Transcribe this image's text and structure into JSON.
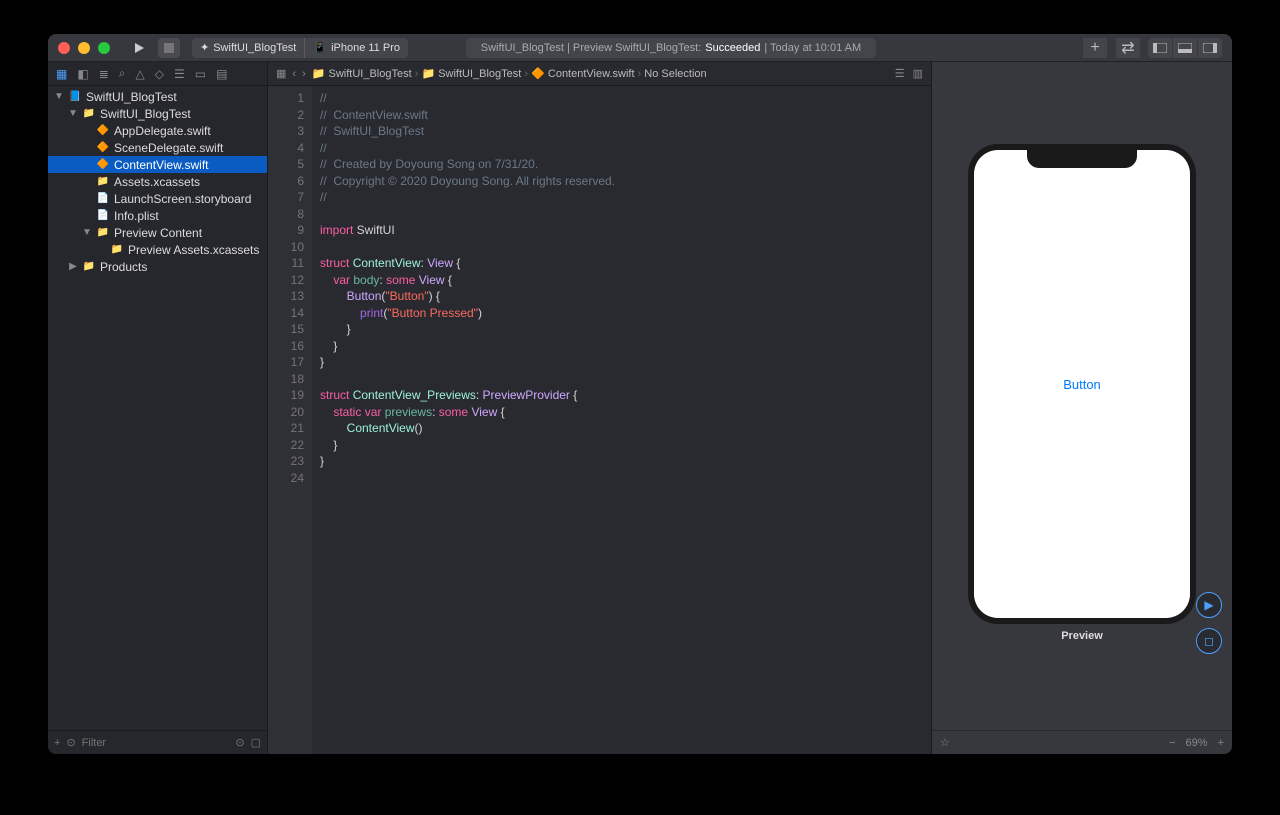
{
  "titlebar": {
    "scheme_app": "SwiftUI_BlogTest",
    "scheme_device": "iPhone 11 Pro",
    "status_prefix": "SwiftUI_BlogTest | Preview SwiftUI_BlogTest:",
    "status_result": "Succeeded",
    "status_time": "| Today at 10:01 AM"
  },
  "navigator": {
    "items": [
      {
        "label": "SwiftUI_BlogTest",
        "depth": 0,
        "icon": "proj",
        "expanded": true
      },
      {
        "label": "SwiftUI_BlogTest",
        "depth": 1,
        "icon": "folder",
        "expanded": true
      },
      {
        "label": "AppDelegate.swift",
        "depth": 2,
        "icon": "swift"
      },
      {
        "label": "SceneDelegate.swift",
        "depth": 2,
        "icon": "swift"
      },
      {
        "label": "ContentView.swift",
        "depth": 2,
        "icon": "swift",
        "selected": true
      },
      {
        "label": "Assets.xcassets",
        "depth": 2,
        "icon": "asset"
      },
      {
        "label": "LaunchScreen.storyboard",
        "depth": 2,
        "icon": "sb"
      },
      {
        "label": "Info.plist",
        "depth": 2,
        "icon": "plist"
      },
      {
        "label": "Preview Content",
        "depth": 2,
        "icon": "folder",
        "expanded": true
      },
      {
        "label": "Preview Assets.xcassets",
        "depth": 3,
        "icon": "asset"
      },
      {
        "label": "Products",
        "depth": 1,
        "icon": "folder",
        "expanded": false
      }
    ],
    "filter_placeholder": "Filter"
  },
  "jumpbar": {
    "crumbs": [
      "SwiftUI_BlogTest",
      "SwiftUI_BlogTest",
      "ContentView.swift",
      "No Selection"
    ]
  },
  "code": {
    "lines": [
      [
        {
          "t": "//",
          "c": "cmt"
        }
      ],
      [
        {
          "t": "//  ContentView.swift",
          "c": "cmt"
        }
      ],
      [
        {
          "t": "//  SwiftUI_BlogTest",
          "c": "cmt"
        }
      ],
      [
        {
          "t": "//",
          "c": "cmt"
        }
      ],
      [
        {
          "t": "//  Created by Doyoung Song on 7/31/20.",
          "c": "cmt"
        }
      ],
      [
        {
          "t": "//  Copyright © 2020 Doyoung Song. All rights reserved.",
          "c": "cmt"
        }
      ],
      [
        {
          "t": "//",
          "c": "cmt"
        }
      ],
      [],
      [
        {
          "t": "import",
          "c": "kw"
        },
        {
          "t": " SwiftUI"
        }
      ],
      [],
      [
        {
          "t": "struct",
          "c": "kw"
        },
        {
          "t": " "
        },
        {
          "t": "ContentView",
          "c": "type"
        },
        {
          "t": ": "
        },
        {
          "t": "View",
          "c": "fn"
        },
        {
          "t": " {"
        }
      ],
      [
        {
          "t": "    "
        },
        {
          "t": "var",
          "c": "kw"
        },
        {
          "t": " "
        },
        {
          "t": "body",
          "c": "id"
        },
        {
          "t": ": "
        },
        {
          "t": "some",
          "c": "kw"
        },
        {
          "t": " "
        },
        {
          "t": "View",
          "c": "fn"
        },
        {
          "t": " {"
        }
      ],
      [
        {
          "t": "        "
        },
        {
          "t": "Button",
          "c": "fn"
        },
        {
          "t": "("
        },
        {
          "t": "\"Button\"",
          "c": "str"
        },
        {
          "t": ") {"
        }
      ],
      [
        {
          "t": "            "
        },
        {
          "t": "print",
          "c": "id2"
        },
        {
          "t": "("
        },
        {
          "t": "\"Button Pressed\"",
          "c": "str"
        },
        {
          "t": ")"
        }
      ],
      [
        {
          "t": "        }"
        }
      ],
      [
        {
          "t": "    }"
        }
      ],
      [
        {
          "t": "}"
        }
      ],
      [],
      [
        {
          "t": "struct",
          "c": "kw"
        },
        {
          "t": " "
        },
        {
          "t": "ContentView_Previews",
          "c": "type"
        },
        {
          "t": ": "
        },
        {
          "t": "PreviewProvider",
          "c": "fn"
        },
        {
          "t": " {"
        }
      ],
      [
        {
          "t": "    "
        },
        {
          "t": "static",
          "c": "kw"
        },
        {
          "t": " "
        },
        {
          "t": "var",
          "c": "kw"
        },
        {
          "t": " "
        },
        {
          "t": "previews",
          "c": "id"
        },
        {
          "t": ": "
        },
        {
          "t": "some",
          "c": "kw"
        },
        {
          "t": " "
        },
        {
          "t": "View",
          "c": "fn"
        },
        {
          "t": " {"
        }
      ],
      [
        {
          "t": "        "
        },
        {
          "t": "ContentView",
          "c": "type"
        },
        {
          "t": "()"
        }
      ],
      [
        {
          "t": "    }"
        }
      ],
      [
        {
          "t": "}"
        }
      ],
      []
    ]
  },
  "canvas": {
    "phone_button": "Button",
    "label": "Preview",
    "zoom": "69%"
  }
}
